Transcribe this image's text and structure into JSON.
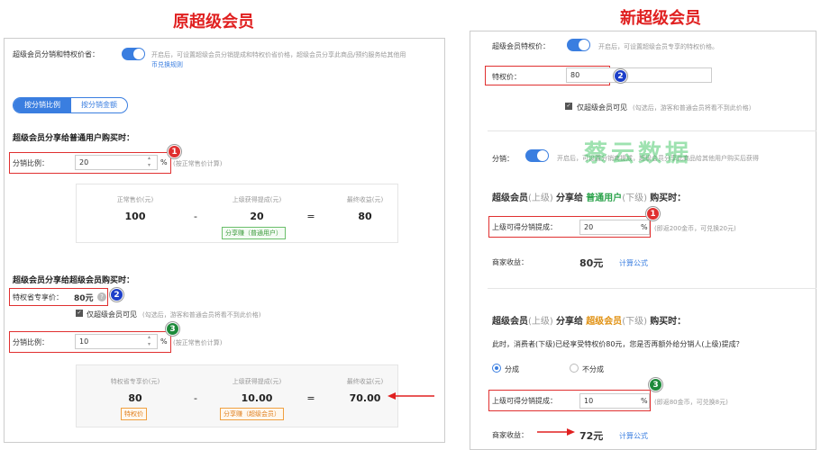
{
  "left": {
    "title": "原超级会员",
    "toggle_label": "超级会员分销和特权价省：",
    "toggle_hint": "开启后，可设置超级会员分销提成和特权价省价格，超级会员分享此商品/预约服务给其他用",
    "toggle_link": "币兑换规则",
    "tab_ratio": "按分销比例",
    "tab_amount": "按分销金额",
    "sec1": "超级会员分享给普通用户购买时：",
    "ratio_label": "分销比例：",
    "ratio1": "20",
    "pct": "%",
    "ratio_hint": "(按正常售价计算)",
    "box1": {
      "c1": "正常售价(元)",
      "c2": "上级获得提成(元)",
      "c3": "最终收益(元)",
      "v1": "100",
      "minus": "-",
      "v2": "20",
      "eq": "=",
      "v3": "80",
      "tag": "分享赚（普通用户）"
    },
    "sec2": "超级会员分享给超级会员购买时：",
    "priv_label": "特权省专享价：",
    "priv_value": "80元",
    "help": "?",
    "check_label": "仅超级会员可见",
    "check_hint": "(勾选后，游客和普通会员将看不到此价格)",
    "ratio2": "10",
    "box2": {
      "c1": "特权省专享价(元)",
      "c2": "上级获得提成(元)",
      "c3": "最终收益(元)",
      "v1": "80",
      "minus": "-",
      "v2": "10.00",
      "eq": "=",
      "v3": "70.00",
      "tag1": "特权价",
      "tag2": "分享赚（超级会员）"
    }
  },
  "right": {
    "title": "新超级会员",
    "toggle_label": "超级会员特权价：",
    "toggle_hint": "开启后，可设置超级会员专享的特权价格。",
    "priv_label": "特权价：",
    "priv_value": "80",
    "check_label": "仅超级会员可见",
    "check_hint": "(勾选后，游客和普通会员将看不到此价格）",
    "dist_label": "分销：",
    "dist_hint": "开启后，可设置分销商提成，超级会员分享此商品给其他用户购买后获得",
    "watermark": "蔡云数据",
    "sec1_a": "超级会员",
    "sec1_b": "(上级)",
    "sec1_c": "分享给",
    "sec1_d": "普通用户",
    "sec1_e": "(下级)",
    "sec1_f": "购买时：",
    "comm_label": "上级可得分销提成：",
    "comm1": "20",
    "pct": "%",
    "comm1_hint": "(即返200金币，可兑换20元)",
    "income_label": "商家收益：",
    "income1": "80元",
    "formula": "计算公式",
    "sec2_a": "超级会员",
    "sec2_b": "(上级)",
    "sec2_c": "分享给",
    "sec2_d": "超级会员",
    "sec2_e": "(下级)",
    "sec2_f": "购买时：",
    "question": "此时，消费者(下级)已经享受特权价80元，您是否再额外给分销人(上级)提成？",
    "opt1": "分成",
    "opt2": "不分成",
    "comm2": "10",
    "comm2_hint": "(即返80金币，可兑换8元)",
    "income2": "72元"
  },
  "badges": {
    "b1": "1",
    "b2": "2",
    "b3": "3"
  },
  "colors": {
    "accent": "#3a7ee0",
    "red": "#e02020"
  }
}
